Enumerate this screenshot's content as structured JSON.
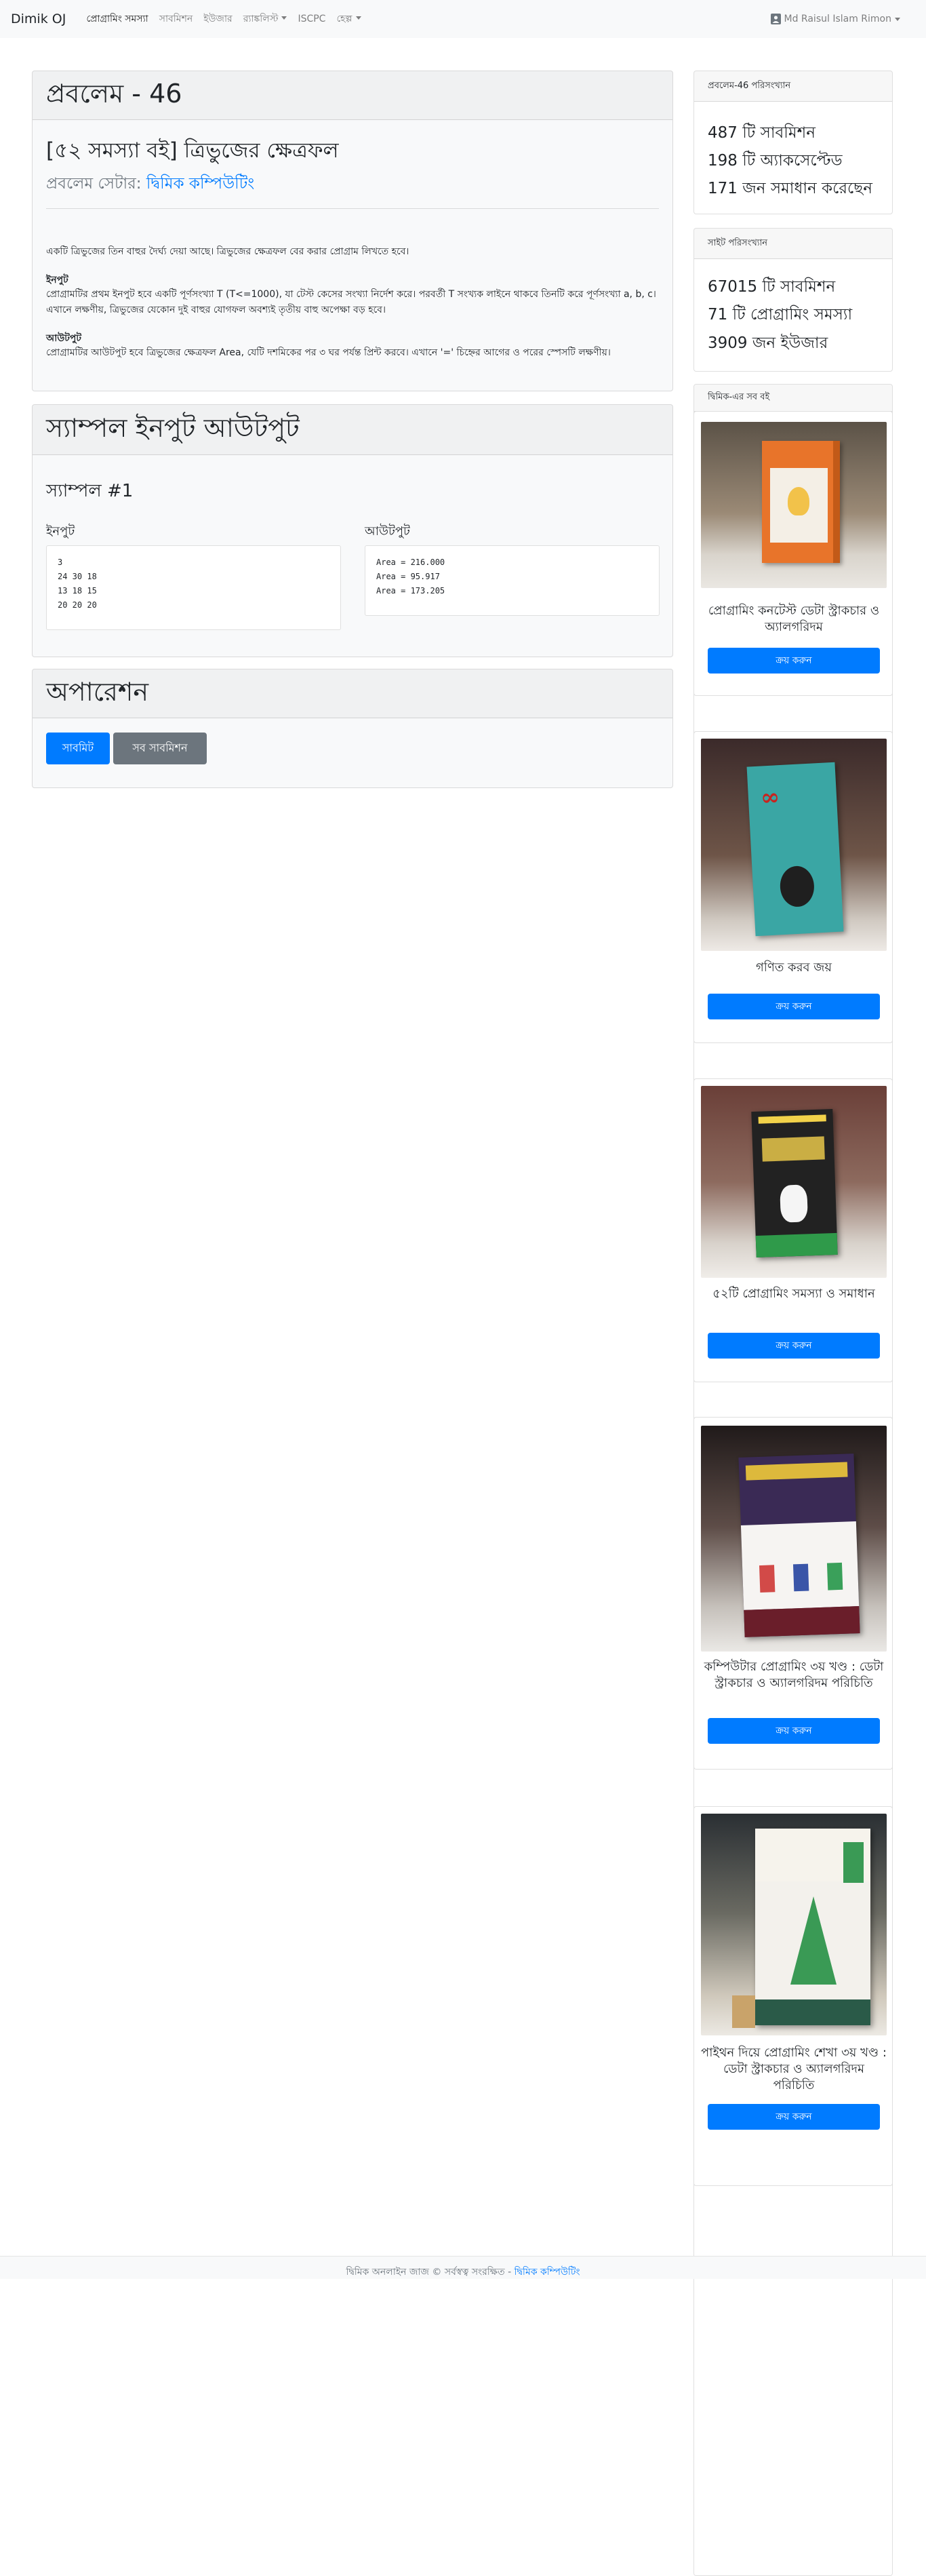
{
  "nav": {
    "brand": "Dimik OJ",
    "links": [
      "প্রোগ্রামিং সমস্যা",
      "সাবমিশন",
      "ইউজার",
      "র‍্যাঙ্কলিস্ট",
      "ISCPC",
      "হেল্প"
    ],
    "user": "Md Raisul Islam Rimon"
  },
  "problem": {
    "heading": "প্রবলেম - 46",
    "title": "[৫২ সমস্যা বই] ত্রিভুজের ক্ষেত্রফল",
    "setter_label": "প্রবলেম সেটার:",
    "setter_name": "দ্বিমিক কম্পিউটিং",
    "statement": "একটি ত্রিভুজের তিন বাহুর দৈর্ঘ্য দেয়া আছে। ত্রিভুজের ক্ষেত্রফল বের করার প্রোগ্রাম লিখতে হবে।",
    "input_head": "ইনপুট",
    "input_text": "প্রোগ্রামটির প্রথম ইনপুট হবে একটি পূর্ণসংখ্যা T (T<=1000), যা টেস্ট কেসের সংখ্যা নির্দেশ করে। পরবর্তী T সংখ্যক লাইনে থাকবে তিনটি করে পূর্ণসংখ্যা a, b, c। এখানে লক্ষণীয়, ত্রিভুজের যেকোন দুই বাহুর যোগফল অবশ্যই তৃতীয় বাহু অপেক্ষা বড় হবে।",
    "output_head": "আউটপুট",
    "output_text": "প্রোগ্রামটির আউটপুট হবে ত্রিভুজের ক্ষেত্রফল Area, যেটি দশমিকের পর ৩ ঘর পর্যন্ত প্রিন্ট করবে। এখানে '=' চিহ্নের আগের ও পরের স্পেসটি লক্ষণীয়।"
  },
  "sample": {
    "heading": "স্যাম্পল ইনপুট আউটপুট",
    "case_label": "স্যাম্পল #1",
    "input_label": "ইনপুট",
    "output_label": "আউটপুট",
    "input": "3\n24 30 18\n13 18 15\n20 20 20",
    "output": "Area = 216.000\nArea = 95.917\nArea = 173.205"
  },
  "operation": {
    "heading": "অপারেশন",
    "submit": "সাবমিট",
    "all_submissions": "সব সাবমিশন"
  },
  "problem_stats": {
    "header": "প্রবলেম-46 পরিসংখ্যান",
    "submissions": "487 টি সাবমিশন",
    "accepted": "198 টি অ্যাকসেপ্টেড",
    "solvers": "171 জন সমাধান করেছেন"
  },
  "site_stats": {
    "header": "সাইট পরিসংখ্যান",
    "submissions": "67015 টি সাবমিশন",
    "problems": "71 টি প্রোগ্রামিং সমস্যা",
    "users": "3909 জন ইউজার"
  },
  "books": {
    "header": "দ্বিমিক-এর সব বই",
    "buy_label": "ক্রয় করুন",
    "items": [
      {
        "title": "প্রোগ্রামিং কনটেস্ট ডেটা স্ট্রাকচার ও অ্যালগরিদম",
        "cover_color": "#e8742a"
      },
      {
        "title": "গণিত করব জয়",
        "cover_color": "#3aa6a4"
      },
      {
        "title": "৫২টি প্রোগ্রামিং সমস্যা ও সমাধান",
        "cover_color": "#222222"
      },
      {
        "title": "কম্পিউটার প্রোগ্রামিং ৩য় খণ্ড : ডেটা স্ট্রাকচার ও অ্যালগরিদম পরিচিতি",
        "cover_color": "#3a2a55"
      },
      {
        "title": "পাইথন দিয়ে প্রোগ্রামিং শেখা ৩য় খণ্ড : ডেটা স্ট্রাকচার ও অ্যালগরিদম পরিচিতি",
        "cover_color": "#2f8a6a"
      }
    ]
  },
  "footer": {
    "text": "দ্বিমিক অনলাইন জাজ © সর্বস্বত্ব সংরক্ষিত -",
    "link": "দ্বিমিক কম্পিউটিং"
  },
  "colors": {
    "primary": "#007bff",
    "secondary": "#6c757d",
    "navbar": "#f8f9fa"
  }
}
